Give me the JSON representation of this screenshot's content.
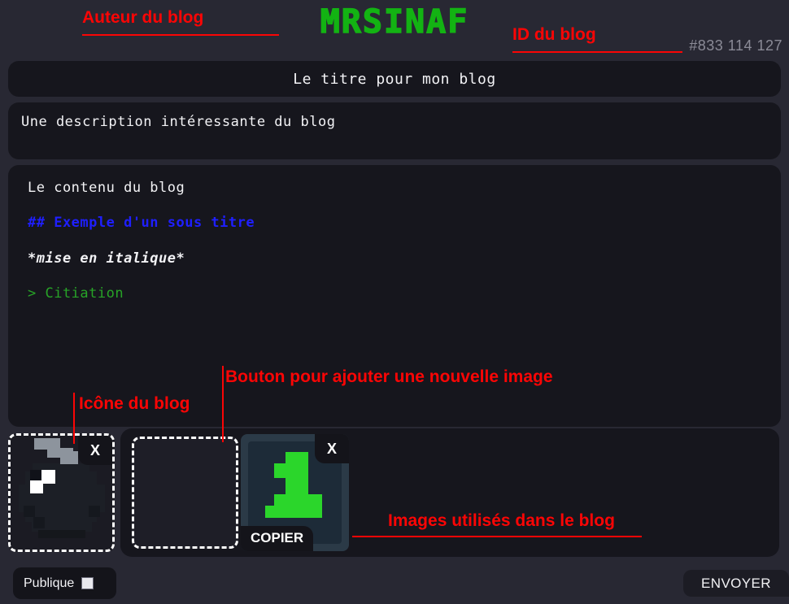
{
  "header": {
    "logo": "MRSINAF",
    "blog_id": "#833 114 127"
  },
  "annotations": [
    {
      "id": "author",
      "text": "Auteur du blog"
    },
    {
      "id": "blog_id",
      "text": "ID du blog"
    },
    {
      "id": "add_image",
      "text": "Bouton pour ajouter une nouvelle image"
    },
    {
      "id": "blog_icon",
      "text": "Icône du blog"
    },
    {
      "id": "used_imgs",
      "text": "Images utilisés dans le blog"
    }
  ],
  "editor": {
    "title": "Le titre pour mon blog",
    "description": "Une description intéressante du blog",
    "content_lines": [
      {
        "text": "Le contenu du blog",
        "style": "plain"
      },
      {
        "text": "## Exemple d'un sous titre",
        "style": "heading"
      },
      {
        "text": "*mise en italique*",
        "style": "italic"
      },
      {
        "text": "> Citiation",
        "style": "quote"
      }
    ]
  },
  "images": {
    "icon_slot": {
      "name": "blog-icon",
      "remove_label": "X"
    },
    "add_slot": {
      "label": ""
    },
    "used": [
      {
        "name": "image-1",
        "remove_label": "X",
        "copy_label": "COPIER"
      }
    ]
  },
  "footer": {
    "visibility_label": "Publique",
    "visibility_checked": true,
    "send_label": "ENVOYER"
  },
  "colors": {
    "page_bg": "#282833",
    "panel_bg": "#16161d",
    "logo_green": "#13b313",
    "annotation_red": "#fb0505",
    "heading_blue": "#1f1fff",
    "quote_green": "#27a327",
    "text": "#f2f2f5",
    "id_gray": "#8b8b97"
  }
}
